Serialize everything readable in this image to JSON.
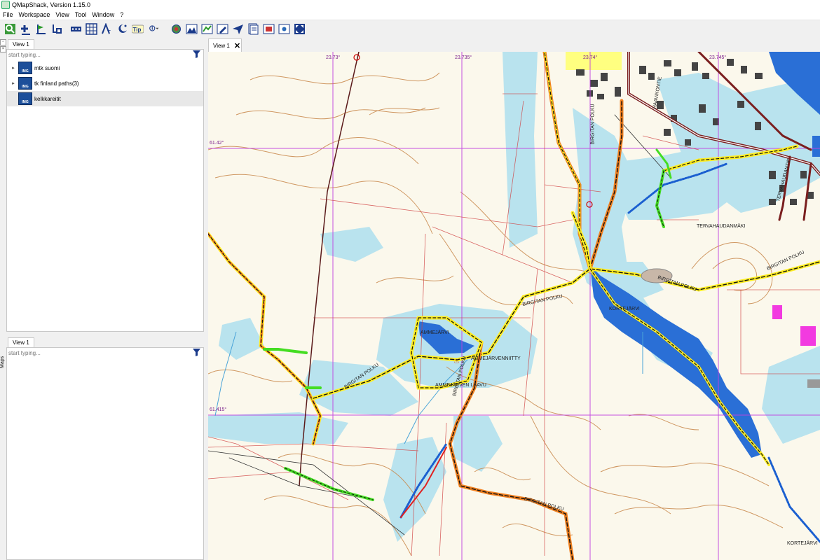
{
  "window": {
    "title": "QMapShack, Version 1.15.0"
  },
  "menu": [
    "File",
    "Workspace",
    "View",
    "Tool",
    "Window",
    "?"
  ],
  "toolbar": {
    "icons": [
      "search-icon",
      "add-waypoint-icon",
      "route-icon",
      "track-icon",
      "ruler-icon",
      "grid-icon",
      "text-tool-icon",
      "night-mode-icon",
      "tooltip-icon",
      "info-icon",
      "dem-icon",
      "map-icon",
      "profile-icon",
      "edit-icon",
      "send-icon",
      "workspace-icon",
      "snapshot-icon",
      "print-icon",
      "fullscreen-icon"
    ],
    "tip_label": "Tip"
  },
  "dock": {
    "label": "Maps"
  },
  "maps_panel": {
    "tab": "View 1",
    "filter_placeholder": "start typing...",
    "items": [
      {
        "label": "mtk suomi",
        "icon_label": "IMG",
        "expandable": true
      },
      {
        "label": "tk finland paths(3)",
        "icon_label": "IMG",
        "expandable": true
      },
      {
        "label": "kelkkareitit",
        "icon_label": "IMG",
        "expandable": false
      }
    ]
  },
  "dem_panel": {
    "tab": "View 1",
    "filter_placeholder": "start typing..."
  },
  "map_tab": {
    "label": "View 1",
    "close": "✕"
  },
  "map": {
    "coords": {
      "lon1": "23.73°",
      "lon2": "23.735°",
      "lon3": "23.74°",
      "lon4": "23.745°",
      "lat1": "61.42°",
      "lat2": "61.415°"
    },
    "labels": {
      "tervahaudanmaki": "TERVAHAUDANMÄKI",
      "kortejarvi": "KORTEJÄRVI",
      "kortejarvi2": "KORTEJÄRVI",
      "ammejarvi": "AMMEJÄRVI",
      "ammejarvenniitty": "AMMEJÄRVENNIITTY",
      "laavu": "AMMEJÄRVEN LAAVU",
      "birgitan1": "BIRGITAN POLKU",
      "birgitan2": "BIRGITAN POLKU",
      "birgitan3": "BIRGITAN POLKU",
      "birgitan4": "BIRGITAN POLKU",
      "birgitan5": "BIRGITAN POLKU",
      "birgitan6": "BIRGITAN POLKU",
      "birgitan7": "BIRGITAN POLKU",
      "haavikontie": "HAAVIKONTIE",
      "tervahaudantie": "TERVAHAUDANTIE"
    }
  }
}
